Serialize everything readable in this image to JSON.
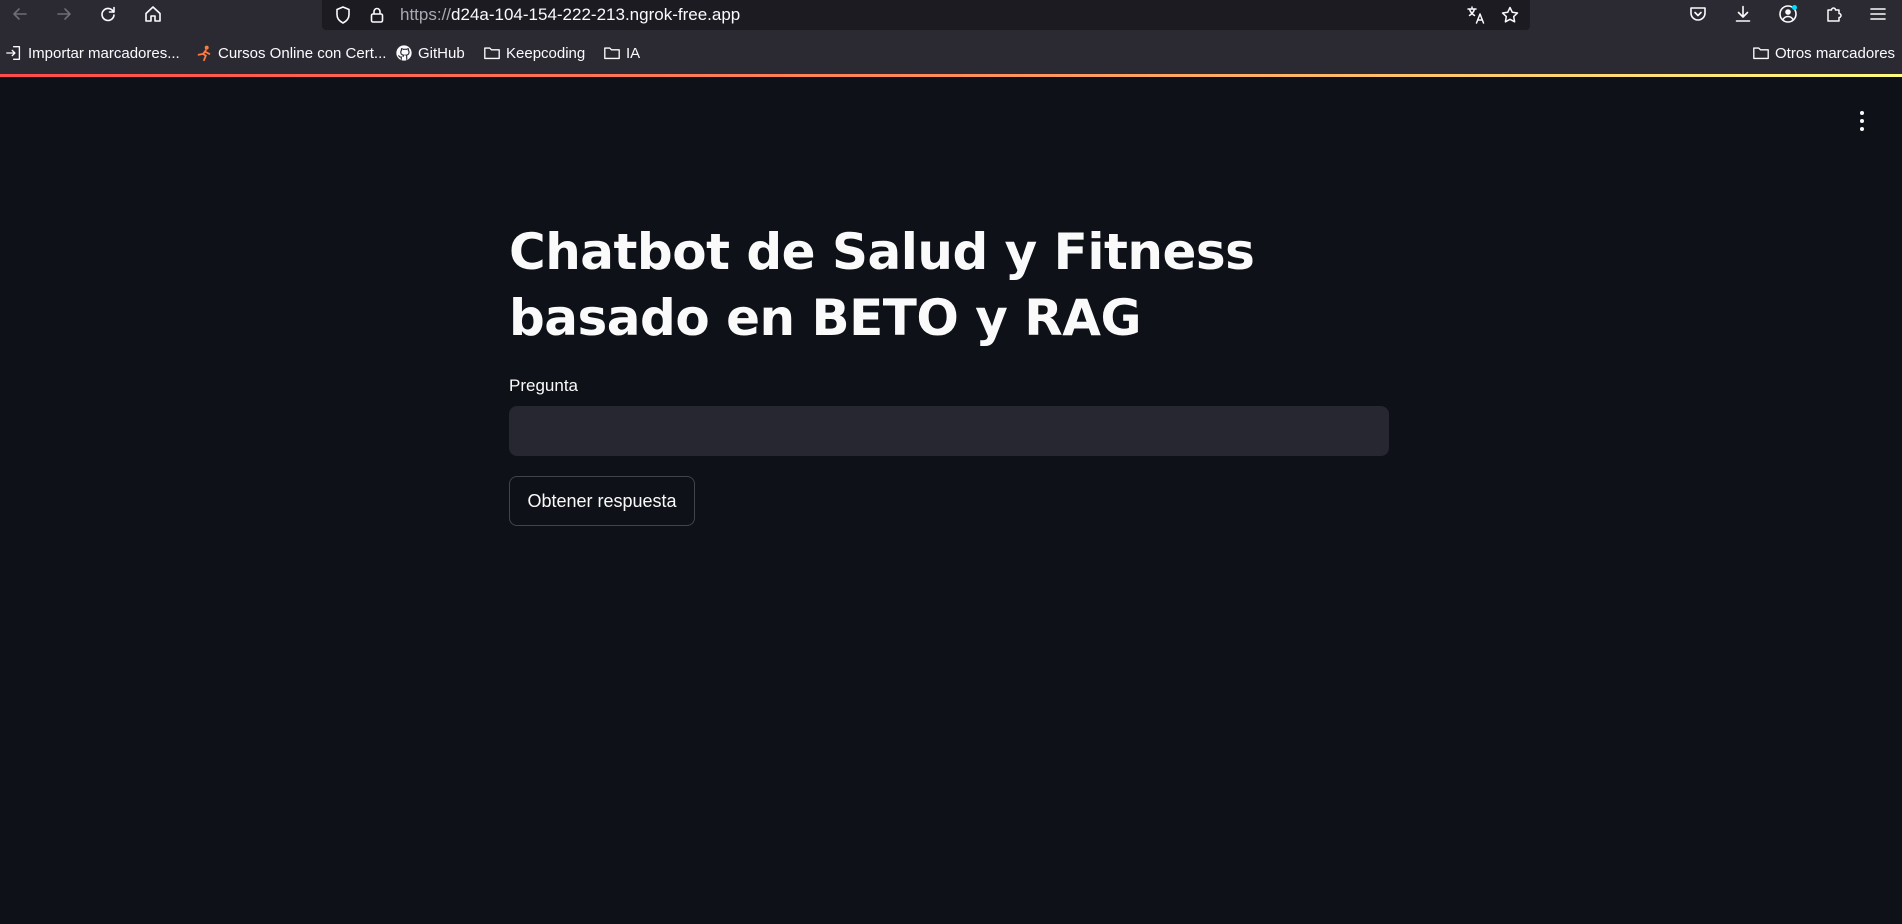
{
  "browser": {
    "url_scheme": "https://",
    "url_host": "d24a-104-154-222-213.ngrok-free.app",
    "bookmarks": [
      {
        "label": "Importar marcadores...",
        "icon": "import-icon"
      },
      {
        "label": "Cursos Online con Cert...",
        "icon": "site-favicon"
      },
      {
        "label": "GitHub",
        "icon": "github-icon"
      },
      {
        "label": "Keepcoding",
        "icon": "folder-icon"
      },
      {
        "label": "IA",
        "icon": "folder-icon"
      }
    ],
    "other_bookmarks": "Otros marcadores"
  },
  "app": {
    "title": "Chatbot de Salud y Fitness basado en BETO y RAG",
    "question_label": "Pregunta",
    "question_value": "",
    "submit_label": "Obtener respuesta",
    "accent_gradient": [
      "#ff4b4b",
      "#fffd80"
    ],
    "background": "#0e1117"
  }
}
